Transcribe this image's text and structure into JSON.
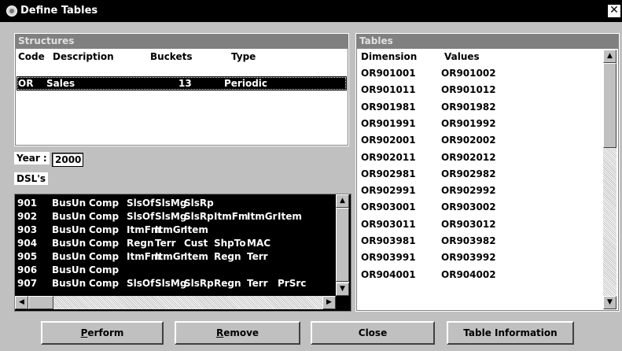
{
  "window": {
    "title": "Define Tables",
    "close": "✕"
  },
  "structures": {
    "header": "Structures",
    "columns": {
      "code": "Code",
      "description": "Description",
      "buckets": "Buckets",
      "type": "Type"
    },
    "rows": [
      {
        "code": "OR",
        "description": "Sales",
        "buckets": "13",
        "type": "Periodic",
        "selected": true
      }
    ]
  },
  "year": {
    "label": "Year :",
    "value": "2000"
  },
  "dsls": {
    "label": "DSL's",
    "rows": [
      {
        "code": "901",
        "fields": [
          "BusUn",
          "Comp",
          "SlsOf",
          "SlsMg",
          "SlsRp"
        ]
      },
      {
        "code": "902",
        "fields": [
          "BusUn",
          "Comp",
          "SlsOf",
          "SlsMg",
          "SlsRp",
          "ItmFm",
          "ItmGr",
          "Item"
        ]
      },
      {
        "code": "903",
        "fields": [
          "BusUn",
          "Comp",
          "ItmFm",
          "ItmGr",
          "Item"
        ]
      },
      {
        "code": "904",
        "fields": [
          "BusUn",
          "Comp",
          "Regn",
          "Terr",
          "Cust",
          "ShpTo",
          "MAC"
        ]
      },
      {
        "code": "905",
        "fields": [
          "BusUn",
          "Comp",
          "ItmFm",
          "ItmGr",
          "Item",
          "Regn",
          "Terr"
        ]
      },
      {
        "code": "906",
        "fields": [
          "BusUn",
          "Comp"
        ]
      },
      {
        "code": "907",
        "fields": [
          "BusUn",
          "Comp",
          "SlsOf",
          "SlsMg",
          "SlsRp",
          "Regn",
          "Terr",
          "PrSrc"
        ]
      }
    ]
  },
  "tables": {
    "header": "Tables",
    "columns": {
      "dimension": "Dimension",
      "values": "Values"
    },
    "rows": [
      {
        "dimension": "OR901001",
        "values": "OR901002"
      },
      {
        "dimension": "OR901011",
        "values": "OR901012"
      },
      {
        "dimension": "OR901981",
        "values": "OR901982"
      },
      {
        "dimension": "OR901991",
        "values": "OR901992"
      },
      {
        "dimension": "OR902001",
        "values": "OR902002"
      },
      {
        "dimension": "OR902011",
        "values": "OR902012"
      },
      {
        "dimension": "OR902981",
        "values": "OR902982"
      },
      {
        "dimension": "OR902991",
        "values": "OR902992"
      },
      {
        "dimension": "OR903001",
        "values": "OR903002"
      },
      {
        "dimension": "OR903011",
        "values": "OR903012"
      },
      {
        "dimension": "OR903981",
        "values": "OR903982"
      },
      {
        "dimension": "OR903991",
        "values": "OR903992"
      },
      {
        "dimension": "OR904001",
        "values": "OR904002"
      }
    ]
  },
  "buttons": {
    "perform": {
      "mnemonic": "P",
      "rest": "erform"
    },
    "remove": {
      "mnemonic": "R",
      "rest": "emove"
    },
    "close": "Close",
    "table_info": "Table Information"
  },
  "icons": {
    "window": "app-icon",
    "close": "close-icon",
    "up": "arrow-up-icon",
    "down": "arrow-down-icon",
    "left": "arrow-left-icon",
    "right": "arrow-right-icon"
  }
}
